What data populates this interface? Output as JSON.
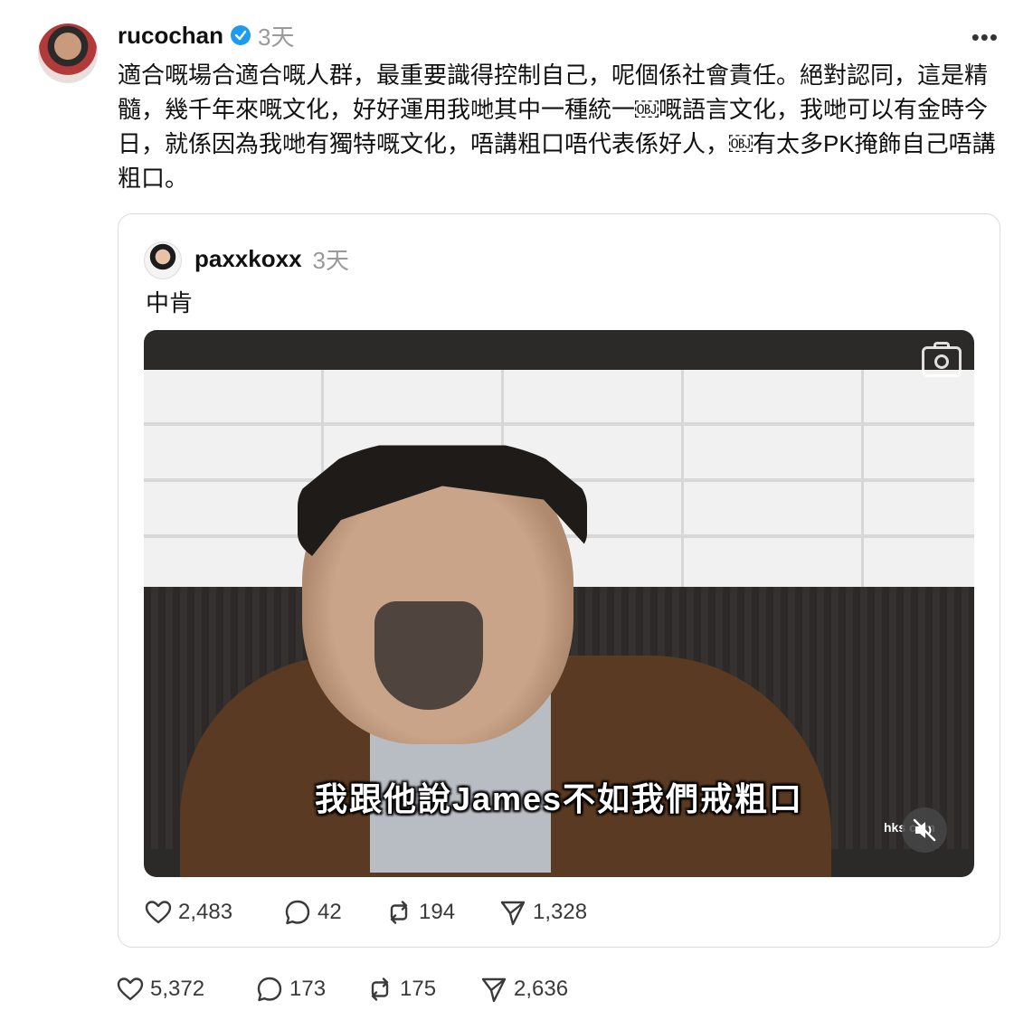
{
  "post": {
    "author": "rucochan",
    "time": "3天",
    "more_icon": "more-horizontal-icon",
    "text": "適合嘅場合適合嘅人群，最重要識得控制自己，呢個係社會責任。絕對認同，這是精髓，幾千年來嘅文化，好好運用我哋其中一種統一￼嘅語言文化，我哋可以有金時今日，就係因為我哋有獨特嘅文化，唔講粗口唔代表係好人，￼有太多PK掩飾自己唔講粗口。",
    "actions": {
      "likes": "5,372",
      "replies": "173",
      "reposts": "175",
      "shares": "2,636"
    }
  },
  "quote": {
    "author": "paxxkoxx",
    "time": "3天",
    "text": "中肯",
    "video": {
      "subtitle": "我跟他說James不如我們戒粗口",
      "watermark": "hks   com",
      "camera_icon": "camera-icon",
      "mute_icon": "volume-muted-icon"
    },
    "actions": {
      "likes": "2,483",
      "replies": "42",
      "reposts": "194",
      "shares": "1,328"
    }
  },
  "colors": {
    "verified": "#1d9bf0",
    "muted_text": "#9a9a9a"
  }
}
